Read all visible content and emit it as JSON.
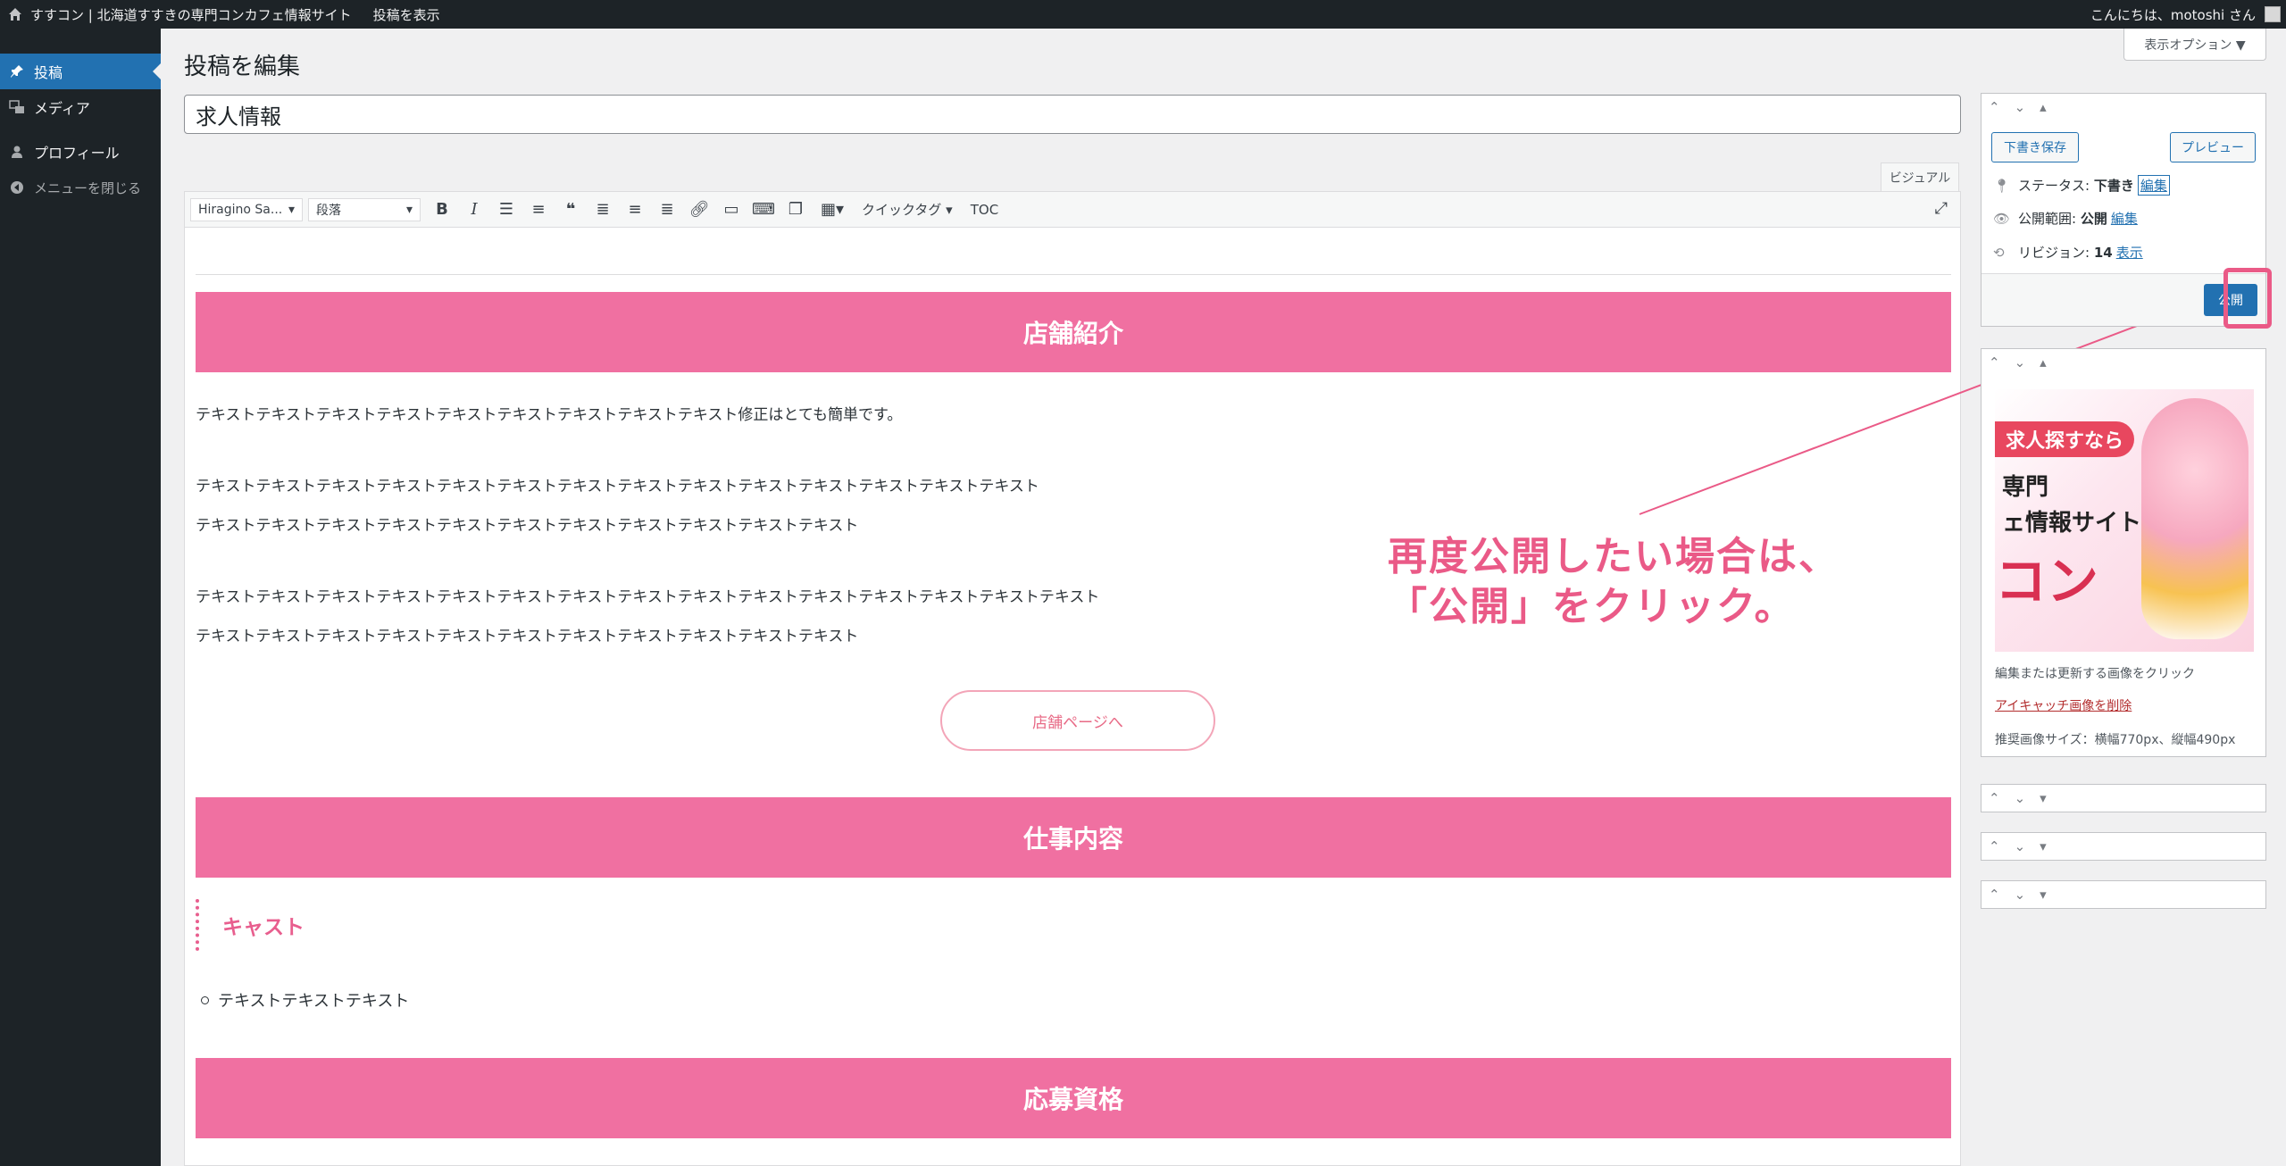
{
  "adminbar": {
    "site_name": "すすコン | 北海道すすきの専門コンカフェ情報サイト",
    "view_post": "投稿を表示",
    "greeting": "こんにちは、motoshi さん"
  },
  "sidebar": {
    "items": [
      {
        "label": "投稿",
        "icon": "pin-icon"
      },
      {
        "label": "メディア",
        "icon": "media-icon"
      },
      {
        "label": "プロフィール",
        "icon": "user-icon"
      },
      {
        "label": "メニューを閉じる",
        "icon": "collapse-icon"
      }
    ]
  },
  "header": {
    "title": "投稿を編集",
    "screen_options": "表示オプション ▼"
  },
  "post": {
    "title": "求人情報"
  },
  "editor": {
    "visual_tab": "ビジュアル",
    "font_select": "Hiragino Sa...",
    "format_select": "段落",
    "quicktag": "クイックタグ",
    "toc": "TOC"
  },
  "content": {
    "heading1": "店舗紹介",
    "p1": "テキストテキストテキストテキストテキストテキストテキストテキストテキスト修正はとても簡単です。",
    "p2a": "テキストテキストテキストテキストテキストテキストテキストテキストテキストテキストテキストテキストテキストテキスト",
    "p2b": "テキストテキストテキストテキストテキストテキストテキストテキストテキストテキストテキスト",
    "p3a": "テキストテキストテキストテキストテキストテキストテキストテキストテキストテキストテキストテキストテキストテキストテキスト",
    "p3b": "テキストテキストテキストテキストテキストテキストテキストテキストテキストテキストテキスト",
    "store_button": "店舗ページへ",
    "heading2": "仕事内容",
    "cast_heading": "キャスト",
    "bullet1": "テキストテキストテキスト",
    "heading3": "応募資格"
  },
  "annotation": {
    "line1": "再度公開したい場合は、",
    "line2": "「公開」をクリック。"
  },
  "publish_box": {
    "save_draft": "下書き保存",
    "preview": "プレビュー",
    "status_label": "ステータス:",
    "status_value": "下書き",
    "status_edit": "編集",
    "visibility_label": "公開範囲:",
    "visibility_value": "公開",
    "visibility_edit": "編集",
    "revisions_label": "リビジョン:",
    "revisions_value": "14",
    "revisions_link": "表示",
    "publish": "公開"
  },
  "featured_box": {
    "img_text1": "求人探すなら",
    "img_text2a": "専門",
    "img_text2b": "ェ情報サイト",
    "img_text3": "コン",
    "hint": "編集または更新する画像をクリック",
    "remove_link": "アイキャッチ画像を削除",
    "recommend": "推奨画像サイズ：横幅770px、縦幅490px"
  },
  "colors": {
    "accent": "#2271b1",
    "heading_pink": "#f070a1",
    "annotation_pink": "#ea5a87"
  }
}
